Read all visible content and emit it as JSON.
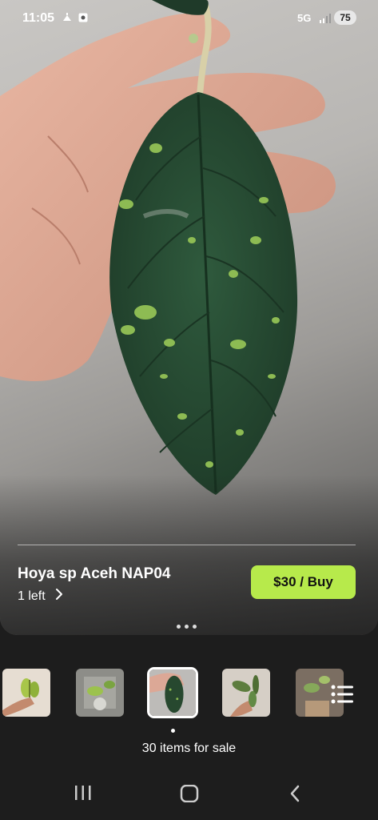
{
  "status_bar": {
    "time": "11:05",
    "network": "5G",
    "battery": "75",
    "left_icons": [
      "weather-icon",
      "notification-icon"
    ]
  },
  "product": {
    "title": "Hoya sp Aceh NAP04",
    "stock": "1 left",
    "buy_label": "$30 / Buy"
  },
  "gallery": {
    "total_thumbs": 5,
    "selected_index": 2
  },
  "listing": {
    "items_count": "30 items for sale"
  },
  "colors": {
    "accent": "#b7ea4b",
    "background": "#1d1d1d",
    "leaf": "#2c4f36"
  }
}
